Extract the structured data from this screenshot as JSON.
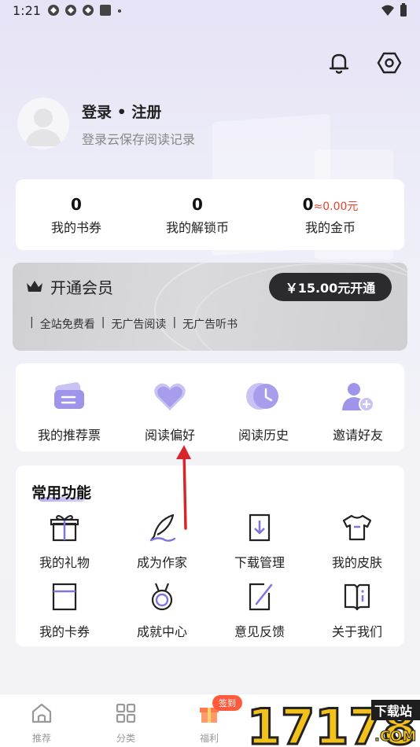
{
  "status_bar": {
    "time": "1:21"
  },
  "profile": {
    "title": "登录 • 注册",
    "subtitle": "登录云保存阅读记录"
  },
  "stats": [
    {
      "value": "0",
      "label": "我的书券"
    },
    {
      "value": "0",
      "label": "我的解锁币"
    },
    {
      "value": "0",
      "extra": "≈0.00元",
      "label": "我的金币"
    }
  ],
  "vip": {
    "title": "开通会员",
    "button": "￥15.00元开通",
    "features": [
      "全站免费看",
      "无广告阅读",
      "无广告听书"
    ]
  },
  "quick_actions": [
    {
      "label": "我的推荐票",
      "icon": "ticket-icon"
    },
    {
      "label": "阅读偏好",
      "icon": "heart-icon"
    },
    {
      "label": "阅读历史",
      "icon": "clock-icon"
    },
    {
      "label": "邀请好友",
      "icon": "add-user-icon"
    }
  ],
  "common": {
    "title": "常用功能",
    "items": [
      {
        "label": "我的礼物",
        "icon": "gift-icon"
      },
      {
        "label": "成为作家",
        "icon": "quill-icon"
      },
      {
        "label": "下载管理",
        "icon": "download-icon"
      },
      {
        "label": "我的皮肤",
        "icon": "tshirt-icon"
      },
      {
        "label": "我的卡券",
        "icon": "card-icon"
      },
      {
        "label": "成就中心",
        "icon": "medal-icon"
      },
      {
        "label": "意见反馈",
        "icon": "feedback-icon"
      },
      {
        "label": "关于我们",
        "icon": "book-info-icon"
      }
    ]
  },
  "bottom_nav": [
    {
      "label": "推荐",
      "icon": "home-icon"
    },
    {
      "label": "分类",
      "icon": "grid-icon"
    },
    {
      "label": "福利",
      "icon": "gift-box-icon",
      "badge": "签到"
    }
  ],
  "watermark": {
    "text": "17178",
    "sub": "下载站",
    "domain": ".COM"
  },
  "colors": {
    "accent": "#7d74e0",
    "coin_red": "#e8422f",
    "vip_button": "#2b2b2e"
  }
}
